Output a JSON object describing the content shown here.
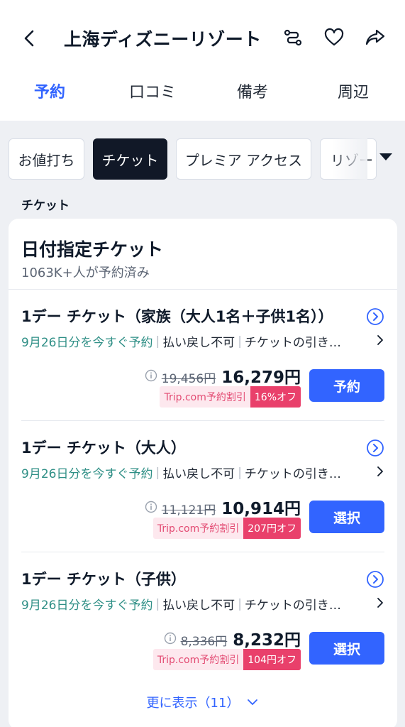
{
  "header": {
    "title": "上海ディズニーリゾート",
    "icons": [
      "back-arrow-icon",
      "route-icon",
      "heart-icon",
      "share-icon"
    ]
  },
  "tabs": [
    {
      "label": "予約",
      "active": true
    },
    {
      "label": "口コミ",
      "active": false
    },
    {
      "label": "備考",
      "active": false
    },
    {
      "label": "周辺",
      "active": false
    }
  ],
  "filters": [
    {
      "label": "お値打ち",
      "active": false
    },
    {
      "label": "チケット",
      "active": true
    },
    {
      "label": "プレミア アクセス",
      "active": false
    },
    {
      "label": "リゾート",
      "active": false
    }
  ],
  "section_label": "チケット",
  "card": {
    "title": "日付指定チケット",
    "subtitle": "1063K+人が予約済み",
    "tickets": [
      {
        "name": "1デー チケット（家族（大人1名＋子供1名））",
        "book_date": "9月26日分を今すぐ予約",
        "refund": "払い戻し不可",
        "pickup": "チケットの引き…",
        "old_price": "19,456円",
        "price": "16,279円",
        "discount_label": "Trip.com予約割引",
        "discount_value": "16%オフ",
        "button": "予約"
      },
      {
        "name": "1デー チケット（大人）",
        "book_date": "9月26日分を今すぐ予約",
        "refund": "払い戻し不可",
        "pickup": "チケットの引き…",
        "old_price": "11,121円",
        "price": "10,914円",
        "discount_label": "Trip.com予約割引",
        "discount_value": "207円オフ",
        "button": "選択"
      },
      {
        "name": "1デー チケット（子供）",
        "book_date": "9月26日分を今すぐ予約",
        "refund": "払い戻し不可",
        "pickup": "チケットの引き…",
        "old_price": "8,336円",
        "price": "8,232円",
        "discount_label": "Trip.com予約割引",
        "discount_value": "104円オフ",
        "button": "選択"
      }
    ],
    "show_more": "更に表示（11）"
  },
  "colors": {
    "accent": "#3264ff",
    "green_text": "#2f8f86",
    "discount_pink": "#e9406b",
    "chip_active": "#111827",
    "background": "#eef0f4"
  }
}
